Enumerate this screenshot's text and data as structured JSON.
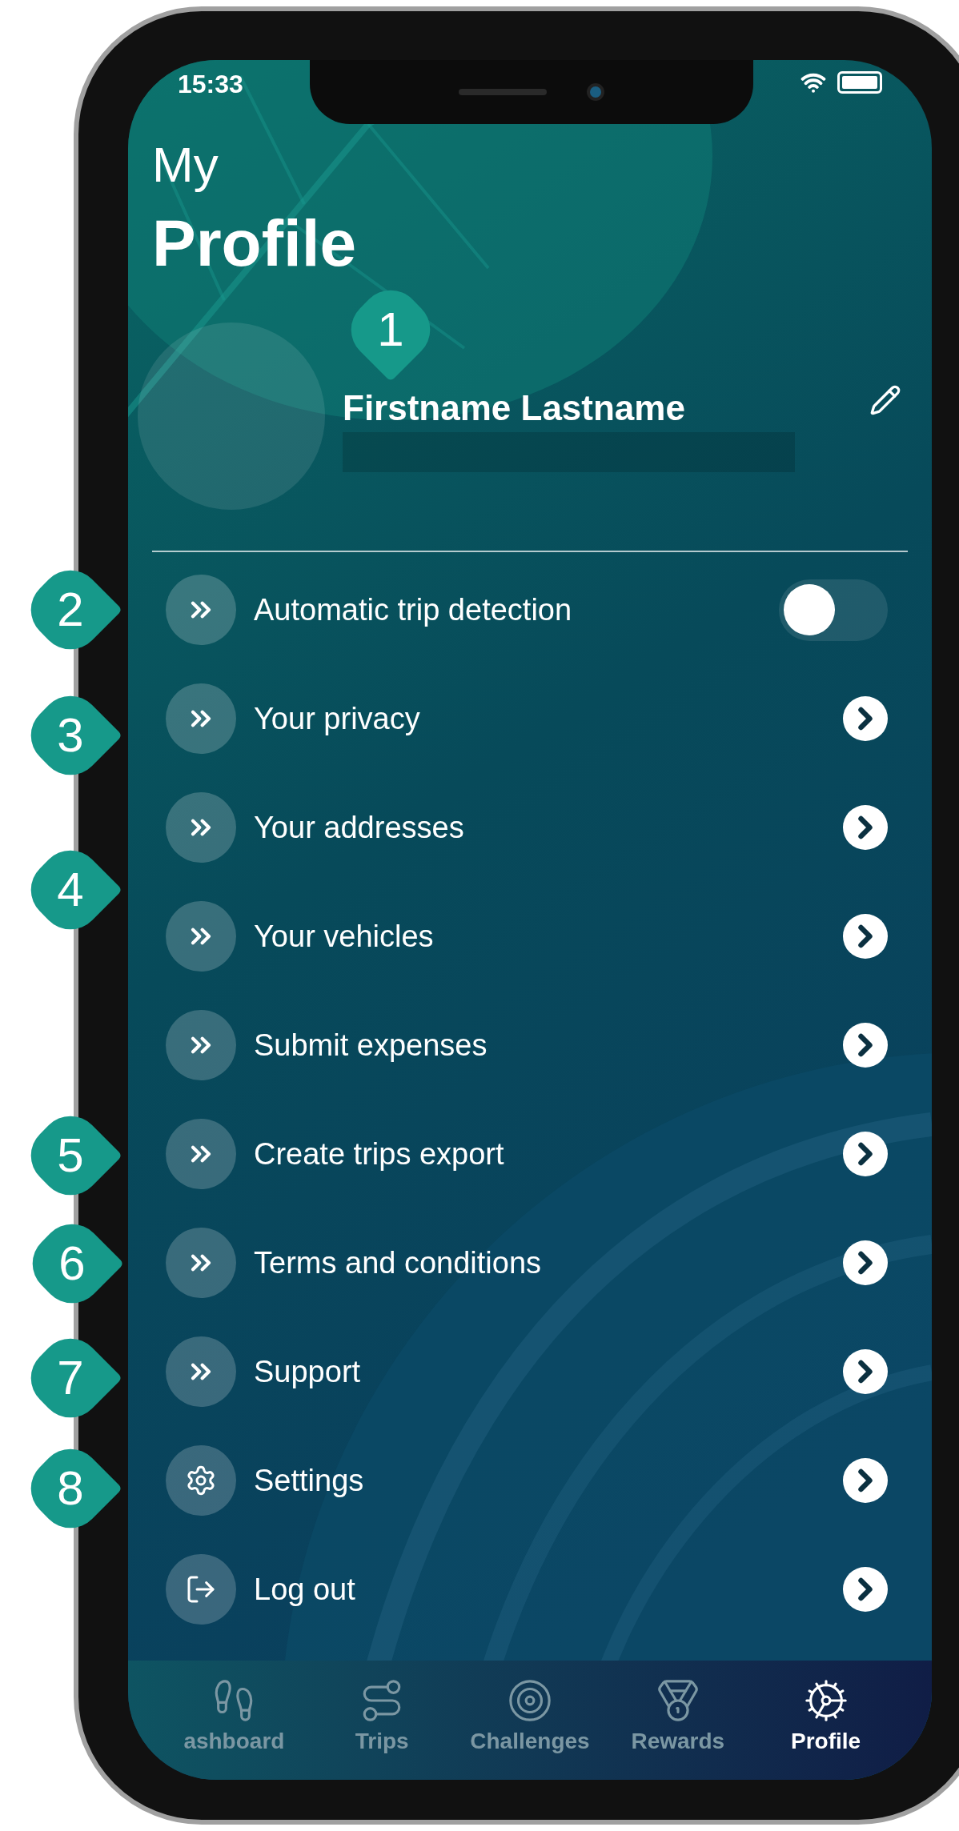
{
  "status_bar": {
    "time": "15:33"
  },
  "header": {
    "line_1": "My",
    "line_2": "Profile"
  },
  "profile": {
    "name": "Firstname Lastname"
  },
  "menu": [
    {
      "kind": "toggle",
      "label": "Automatic trip detection",
      "on": false
    },
    {
      "kind": "link",
      "label": "Your privacy"
    },
    {
      "kind": "link",
      "label": "Your addresses"
    },
    {
      "kind": "link",
      "label": "Your vehicles"
    },
    {
      "kind": "link",
      "label": "Submit expenses"
    },
    {
      "kind": "link",
      "label": "Create trips export"
    },
    {
      "kind": "link",
      "label": "Terms and conditions"
    },
    {
      "kind": "link",
      "label": "Support"
    },
    {
      "kind": "settings",
      "label": "Settings"
    },
    {
      "kind": "logout",
      "label": "Log out"
    }
  ],
  "callouts": [
    "1",
    "2",
    "3",
    "4",
    "5",
    "6",
    "7",
    "8"
  ],
  "tabs": [
    {
      "kind": "dashboard",
      "label": "ashboard",
      "selected": false
    },
    {
      "kind": "trips",
      "label": "Trips",
      "selected": false
    },
    {
      "kind": "challenges",
      "label": "Challenges",
      "selected": false
    },
    {
      "kind": "rewards",
      "label": "Rewards",
      "selected": false
    },
    {
      "kind": "profile",
      "label": "Profile",
      "selected": true
    }
  ]
}
